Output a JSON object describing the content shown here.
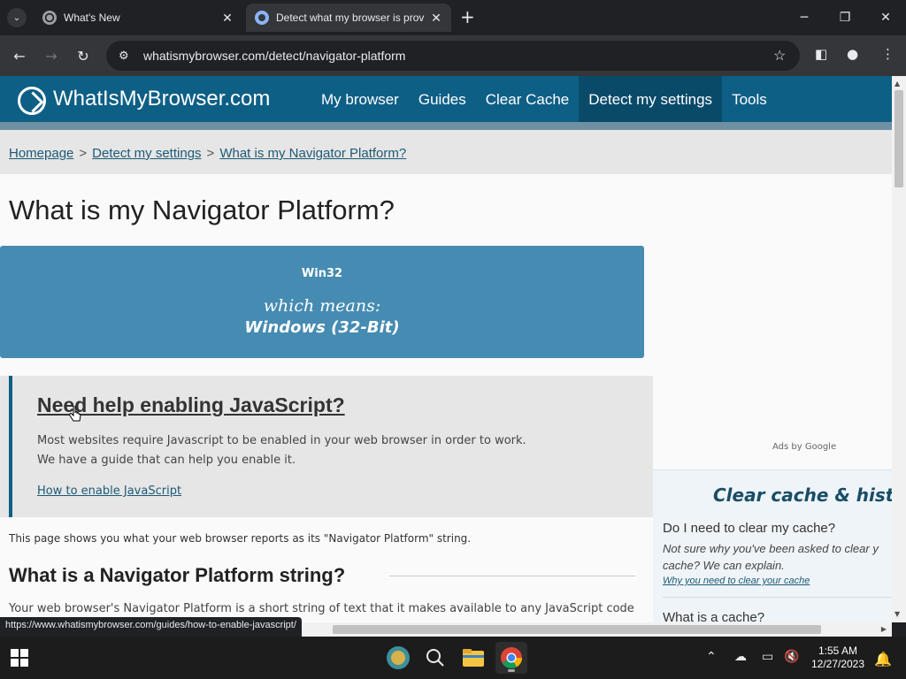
{
  "browser": {
    "tabs": [
      {
        "title": "What's New",
        "active": false
      },
      {
        "title": "Detect what my browser is prov",
        "active": true
      }
    ],
    "url": "whatismybrowser.com/detect/navigator-platform",
    "status_url": "https://www.whatismybrowser.com/guides/how-to-enable-javascript/"
  },
  "site": {
    "logo": "WhatIsMyBrowser.com",
    "nav": [
      "My browser",
      "Guides",
      "Clear Cache",
      "Detect my settings",
      "Tools"
    ],
    "active_nav": "Detect my settings",
    "breadcrumb": {
      "home": "Homepage",
      "sep": ">",
      "section": "Detect my settings",
      "current": "What is my Navigator Platform?"
    }
  },
  "main": {
    "title": "What is my Navigator Platform?",
    "result": {
      "value": "Win32",
      "means_label": "which means:",
      "meaning": "Windows (32-Bit)"
    },
    "js_help": {
      "heading": "Need help enabling JavaScript?",
      "line1": "Most websites require Javascript to be enabled in your web browser in order to work.",
      "line2": "We have a guide that can help you enable it.",
      "link": "How to enable JavaScript"
    },
    "intro": "This page shows you what your web browser reports as its \"Navigator Platform\" string.",
    "section_title": "What is a Navigator Platform string?",
    "section_text": "Your web browser's Navigator Platform is a short string of text that it makes available to any JavaScript code"
  },
  "sidebar": {
    "ads_label": "Ads by Google",
    "title": "Clear cache & history",
    "q1": "Do I need to clear my cache?",
    "d1": "Not sure why you've been asked to clear y cache? We can explain.",
    "l1": "Why you need to clear your cache",
    "q2": "What is a cache?"
  },
  "taskbar": {
    "time": "1:55 AM",
    "date": "12/27/2023"
  },
  "colors": {
    "site_header": "#0e5f86",
    "result_box": "#468bb2",
    "browser_dark": "#202124"
  }
}
